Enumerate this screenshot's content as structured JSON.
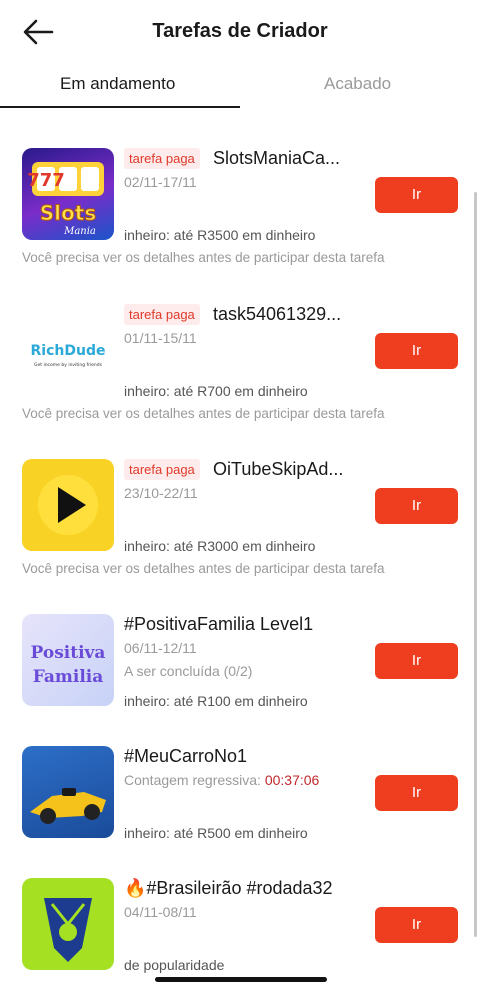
{
  "header": {
    "title": "Tarefas de Criador",
    "back_icon": "arrow-left-icon"
  },
  "tabs": [
    {
      "label": "Em andamento",
      "active": true
    },
    {
      "label": "Acabado",
      "active": false
    }
  ],
  "tasks": [
    {
      "badge": "tarefa paga",
      "name": "SlotsManiaCa...",
      "date": "02/11-17/11",
      "reward": "inheiro: até R3500 em dinheiro",
      "note": "Você precisa ver os detalhes antes de participar desta tarefa",
      "button": "Ir",
      "thumb_text_1": "Slots",
      "thumb_text_2": "Mania",
      "thumb_text_3": "777"
    },
    {
      "badge": "tarefa paga",
      "name": "task54061329...",
      "date": "01/11-15/11",
      "reward": "inheiro: até R700 em dinheiro",
      "note": "Você precisa ver os detalhes antes de participar desta tarefa",
      "button": "Ir",
      "thumb_text_1": "RichDude",
      "thumb_text_2": "Get income by inviting friends"
    },
    {
      "badge": "tarefa paga",
      "name": "OiTubeSkipAd...",
      "date": "23/10-22/11",
      "reward": "inheiro: até R3000 em dinheiro",
      "note": "Você precisa ver os detalhes antes de participar desta tarefa",
      "button": "Ir"
    },
    {
      "name": "#PositivaFamilia Level1",
      "date": "06/11-12/11",
      "status": "A ser concluída (0/2)",
      "reward": "inheiro: até R100 em dinheiro",
      "button": "Ir",
      "thumb_text_1": "Positiva",
      "thumb_text_2": "Familia"
    },
    {
      "name": "#MeuCarroNo1",
      "countdown_label": "Contagem regressiva: ",
      "countdown_value": "00:37:06",
      "reward": "inheiro: até R500 em dinheiro",
      "button": "Ir"
    },
    {
      "name": "🔥#Brasileirão #rodada32",
      "date": "04/11-08/11",
      "reward": "de popularidade",
      "button": "Ir"
    }
  ],
  "colors": {
    "accent": "#ee3e1f",
    "badge_text": "#e0392b",
    "badge_bg": "#fdeceb",
    "countdown": "#c0282c"
  }
}
